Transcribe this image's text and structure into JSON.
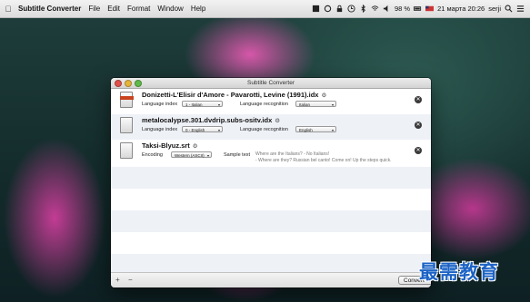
{
  "menubar": {
    "apple_icon": "apple-icon",
    "app_name": "Subtitle Converter",
    "items": [
      "File",
      "Edit",
      "Format",
      "Window",
      "Help"
    ],
    "battery": "98 %",
    "date_time": "21 марта  20:26",
    "user": "serji"
  },
  "window": {
    "title": "Subtitle Converter",
    "rows": [
      {
        "filename": "Donizetti-L'Elisir d'Amore - Pavarotti, Levine (1991).idx",
        "field1_label": "Language index",
        "field1_value": "1 - Italian",
        "field2_label": "Language recognition",
        "field2_value": "Italian"
      },
      {
        "filename": "metalocalypse.301.dvdrip.subs-ositv.idx",
        "field1_label": "Language index",
        "field1_value": "0 - English",
        "field2_label": "Language recognition",
        "field2_value": "English"
      },
      {
        "filename": "Taksi-Blyuz.srt",
        "field1_label": "Encoding",
        "field1_value": "Western (ASCII)",
        "field2_label": "Sample text",
        "sample_line1": "Where are the Italians? - No Italians!",
        "sample_line2": "- Where are they? Russian bel canto! Come on! Up the steps quick."
      }
    ],
    "add_label": "+",
    "remove_label": "−",
    "convert_label": "Convert"
  },
  "watermark": "最需教育"
}
